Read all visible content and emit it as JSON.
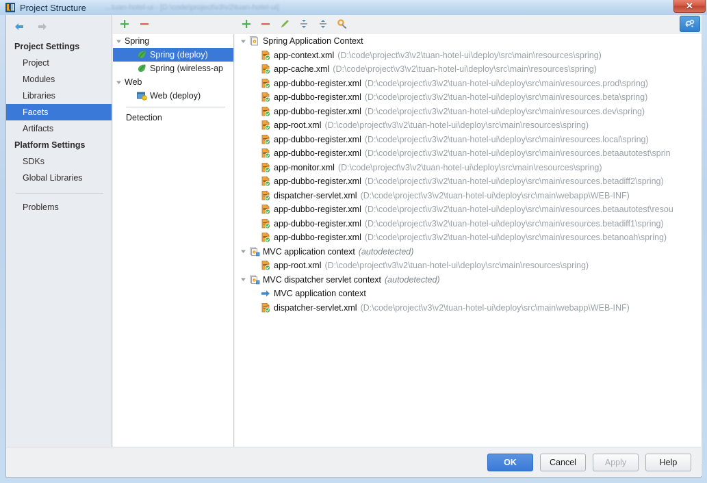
{
  "window": {
    "title": "Project Structure",
    "ghost_text": "...tuan-hotel-ui - [D:\\code\\project\\v3\\v2\\tuan-hotel-ui]",
    "close_label": "✕",
    "icon_name": "intellij-idea-icon"
  },
  "sidebar": {
    "back_icon": "back-arrow-icon",
    "forward_icon": "forward-arrow-icon",
    "groups": [
      {
        "title": "Project Settings",
        "items": [
          {
            "label": "Project",
            "selected": false
          },
          {
            "label": "Modules",
            "selected": false
          },
          {
            "label": "Libraries",
            "selected": false
          },
          {
            "label": "Facets",
            "selected": true
          },
          {
            "label": "Artifacts",
            "selected": false
          }
        ]
      },
      {
        "title": "Platform Settings",
        "items": [
          {
            "label": "SDKs",
            "selected": false
          },
          {
            "label": "Global Libraries",
            "selected": false
          }
        ]
      }
    ],
    "problems_label": "Problems"
  },
  "facet_panel": {
    "toolbar": [
      {
        "name": "add-facet-button",
        "icon": "plus-icon"
      },
      {
        "name": "remove-facet-button",
        "icon": "minus-icon"
      }
    ],
    "tree": [
      {
        "label": "Spring",
        "type": "group",
        "expanded": true,
        "selected": false,
        "icon": "none"
      },
      {
        "label": "Spring (deploy)",
        "type": "leaf",
        "selected": true,
        "icon": "spring-leaf-icon"
      },
      {
        "label": "Spring (wireless-ap",
        "type": "leaf",
        "selected": false,
        "icon": "spring-leaf-icon"
      },
      {
        "label": "Web",
        "type": "group",
        "expanded": true,
        "selected": false,
        "icon": "none"
      },
      {
        "label": "Web (deploy)",
        "type": "leaf",
        "selected": false,
        "icon": "web-facet-icon"
      }
    ],
    "detection_label": "Detection"
  },
  "detail_panel": {
    "toolbar": [
      {
        "name": "add-context-button",
        "icon": "plus-icon"
      },
      {
        "name": "remove-context-button",
        "icon": "minus-icon"
      },
      {
        "name": "edit-context-button",
        "icon": "pencil-icon"
      },
      {
        "name": "expand-all-button",
        "icon": "expand-all-icon"
      },
      {
        "name": "collapse-all-button",
        "icon": "collapse-all-icon"
      },
      {
        "name": "configure-button",
        "icon": "wrench-gear-icon"
      }
    ],
    "help_button_icon": "spring-config-icon",
    "tree": [
      {
        "level": 0,
        "icon": "context-stack-icon",
        "name": "Spring Application Context",
        "path": "",
        "italic": "",
        "expanded": true
      },
      {
        "level": 1,
        "icon": "xml-spring-file-icon",
        "name": "app-context.xml",
        "path": "(D:\\code\\project\\v3\\v2\\tuan-hotel-ui\\deploy\\src\\main\\resources\\spring)"
      },
      {
        "level": 1,
        "icon": "xml-spring-file-icon",
        "name": "app-cache.xml",
        "path": "(D:\\code\\project\\v3\\v2\\tuan-hotel-ui\\deploy\\src\\main\\resources\\spring)"
      },
      {
        "level": 1,
        "icon": "xml-spring-file-icon",
        "name": "app-dubbo-register.xml",
        "path": "(D:\\code\\project\\v3\\v2\\tuan-hotel-ui\\deploy\\src\\main\\resources.prod\\spring)"
      },
      {
        "level": 1,
        "icon": "xml-spring-file-icon",
        "name": "app-dubbo-register.xml",
        "path": "(D:\\code\\project\\v3\\v2\\tuan-hotel-ui\\deploy\\src\\main\\resources.beta\\spring)"
      },
      {
        "level": 1,
        "icon": "xml-spring-file-icon",
        "name": "app-dubbo-register.xml",
        "path": "(D:\\code\\project\\v3\\v2\\tuan-hotel-ui\\deploy\\src\\main\\resources.dev\\spring)"
      },
      {
        "level": 1,
        "icon": "xml-spring-file-icon",
        "name": "app-root.xml",
        "path": "(D:\\code\\project\\v3\\v2\\tuan-hotel-ui\\deploy\\src\\main\\resources\\spring)"
      },
      {
        "level": 1,
        "icon": "xml-spring-file-icon",
        "name": "app-dubbo-register.xml",
        "path": "(D:\\code\\project\\v3\\v2\\tuan-hotel-ui\\deploy\\src\\main\\resources.local\\spring)"
      },
      {
        "level": 1,
        "icon": "xml-spring-file-icon",
        "name": "app-dubbo-register.xml",
        "path": "(D:\\code\\project\\v3\\v2\\tuan-hotel-ui\\deploy\\src\\main\\resources.betaautotest\\sprin"
      },
      {
        "level": 1,
        "icon": "xml-spring-file-icon",
        "name": "app-monitor.xml",
        "path": "(D:\\code\\project\\v3\\v2\\tuan-hotel-ui\\deploy\\src\\main\\resources\\spring)"
      },
      {
        "level": 1,
        "icon": "xml-spring-file-icon",
        "name": "app-dubbo-register.xml",
        "path": "(D:\\code\\project\\v3\\v2\\tuan-hotel-ui\\deploy\\src\\main\\resources.betadiff2\\spring)"
      },
      {
        "level": 1,
        "icon": "xml-spring-file-icon",
        "name": "dispatcher-servlet.xml",
        "path": "(D:\\code\\project\\v3\\v2\\tuan-hotel-ui\\deploy\\src\\main\\webapp\\WEB-INF)"
      },
      {
        "level": 1,
        "icon": "xml-spring-file-icon",
        "name": "app-dubbo-register.xml",
        "path": "(D:\\code\\project\\v3\\v2\\tuan-hotel-ui\\deploy\\src\\main\\resources.betaautotest\\resou"
      },
      {
        "level": 1,
        "icon": "xml-spring-file-icon",
        "name": "app-dubbo-register.xml",
        "path": "(D:\\code\\project\\v3\\v2\\tuan-hotel-ui\\deploy\\src\\main\\resources.betadiff1\\spring)"
      },
      {
        "level": 1,
        "icon": "xml-spring-file-icon",
        "name": "app-dubbo-register.xml",
        "path": "(D:\\code\\project\\v3\\v2\\tuan-hotel-ui\\deploy\\src\\main\\resources.betanoah\\spring)"
      },
      {
        "level": 0,
        "icon": "mvc-context-icon",
        "name": "MVC application context",
        "path": "",
        "italic": "(autodetected)",
        "expanded": true
      },
      {
        "level": 1,
        "icon": "xml-spring-file-icon",
        "name": "app-root.xml",
        "path": "(D:\\code\\project\\v3\\v2\\tuan-hotel-ui\\deploy\\src\\main\\resources\\spring)"
      },
      {
        "level": 0,
        "icon": "mvc-context-icon",
        "name": "MVC dispatcher servlet context",
        "path": "",
        "italic": "(autodetected)",
        "expanded": true
      },
      {
        "level": 1,
        "icon": "blue-arrow-icon",
        "name": "MVC application context",
        "path": ""
      },
      {
        "level": 1,
        "icon": "xml-spring-file-icon",
        "name": "dispatcher-servlet.xml",
        "path": "(D:\\code\\project\\v3\\v2\\tuan-hotel-ui\\deploy\\src\\main\\webapp\\WEB-INF)"
      }
    ]
  },
  "buttons": {
    "ok": "OK",
    "cancel": "Cancel",
    "apply": "Apply",
    "help": "Help"
  },
  "colors": {
    "selection_blue": "#3b79d8",
    "path_gray": "#9aa0a6",
    "toolbar_bg": "#eef0f2"
  }
}
